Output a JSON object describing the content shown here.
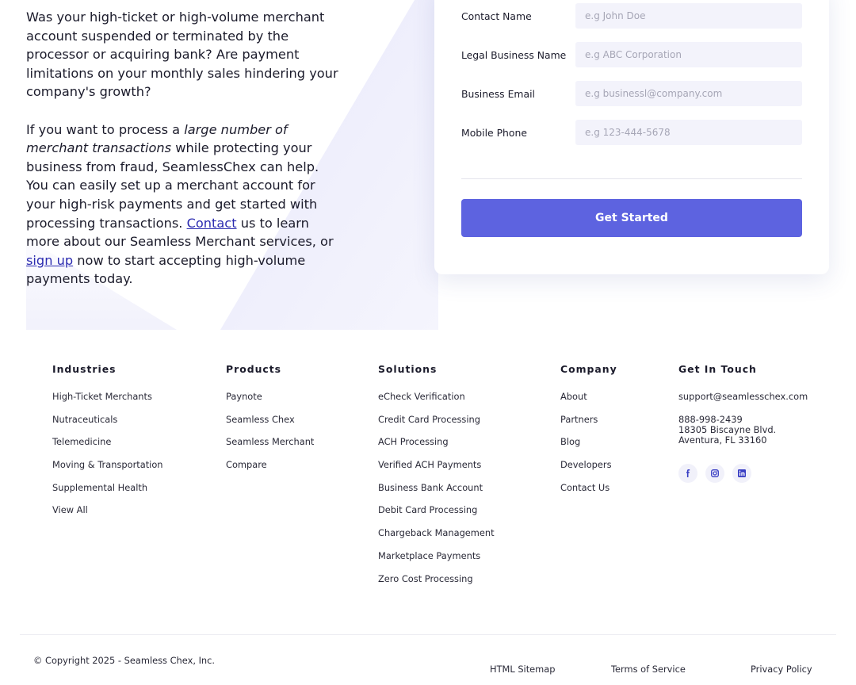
{
  "intro": {
    "p1": "Was your high-ticket or high-volume merchant account suspended or terminated by the processor or acquiring bank? Are payment limitations on your monthly sales hindering your company's growth?",
    "p2_a": "If you want to process a ",
    "p2_em": "large number of merchant transactions",
    "p2_b": " while protecting your business from fraud, SeamlessChex can help. You can easily set up a merchant account for your high-risk payments and get started with processing transactions. ",
    "contact_link": "Contact",
    "p2_c": " us to learn more about our Seamless Merchant services, or ",
    "signup_link": "sign up",
    "p2_d": " now to start accepting high-volume payments today."
  },
  "form": {
    "fields": [
      {
        "label": "Contact Name",
        "placeholder": "e.g John Doe"
      },
      {
        "label": "Legal Business Name",
        "placeholder": "e.g ABC Corporation"
      },
      {
        "label": "Business Email",
        "placeholder": "e.g businessl@company.com"
      },
      {
        "label": "Mobile Phone",
        "placeholder": "e.g 123-444-5678"
      }
    ],
    "submit_label": "Get Started"
  },
  "footer": {
    "industries": {
      "title": "Industries",
      "items": [
        "High-Ticket Merchants",
        "Nutraceuticals",
        "Telemedicine",
        "Moving & Transportation",
        "Supplemental Health",
        "View All"
      ]
    },
    "products": {
      "title": "Products",
      "items": [
        "Paynote",
        "Seamless Chex",
        "Seamless Merchant",
        "Compare"
      ]
    },
    "solutions": {
      "title": "Solutions",
      "items": [
        "eCheck Verification",
        "Credit Card Processing",
        "ACH Processing",
        "Verified ACH Payments",
        "Business Bank Account",
        "Debit Card Processing",
        "Chargeback Management",
        "Marketplace Payments",
        "Zero Cost Processing"
      ]
    },
    "company": {
      "title": "Company",
      "items": [
        "About",
        "Partners",
        "Blog",
        "Developers",
        "Contact Us"
      ]
    },
    "contact": {
      "title": "Get In Touch",
      "email": "support@seamlesschex.com",
      "phone": "888-998-2439",
      "address_line1": "18305 Biscayne Blvd.",
      "address_line2": "Aventura, FL 33160",
      "socials": [
        "facebook-icon",
        "instagram-icon",
        "linkedin-icon"
      ]
    },
    "copyright": "© Copyright 2025 - Seamless Chex, Inc.",
    "bottom_links": [
      "HTML Sitemap",
      "Terms of Service",
      "Privacy Policy"
    ]
  },
  "colors": {
    "accent": "#5d63e0",
    "link": "#2b2bb0",
    "input_bg": "#f3f3fb"
  }
}
